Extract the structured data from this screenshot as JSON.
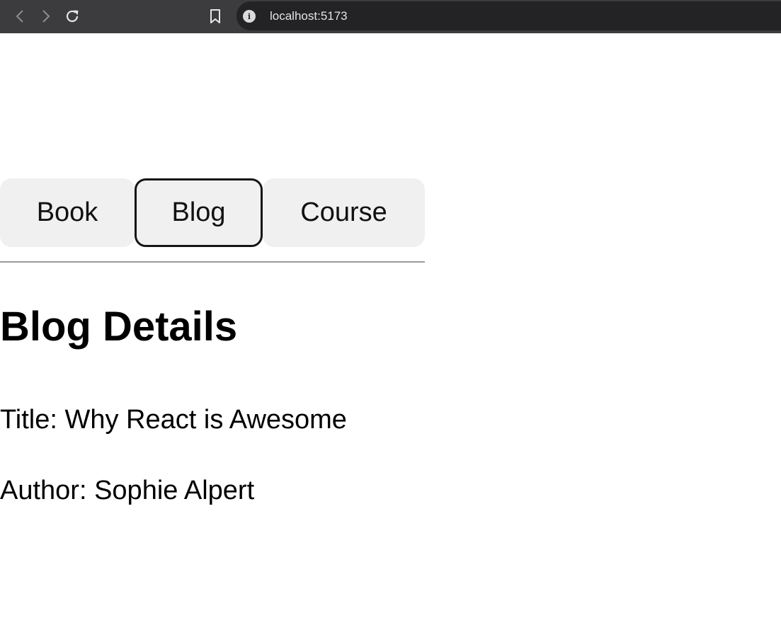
{
  "browser": {
    "url": "localhost:5173",
    "icons": {
      "back": "chevron-left-icon",
      "forward": "chevron-right-icon",
      "reload": "reload-icon",
      "bookmark": "bookmark-icon",
      "site_info": "info-icon"
    }
  },
  "tabs": [
    {
      "label": "Book",
      "selected": false
    },
    {
      "label": "Blog",
      "selected": true
    },
    {
      "label": "Course",
      "selected": false
    }
  ],
  "details": {
    "heading": "Blog Details",
    "title_line": "Title: Why React is Awesome",
    "author_line": "Author: Sophie Alpert"
  },
  "colors": {
    "browser_bar": "#3c3c3f",
    "address_bar": "#232326",
    "tab_background": "#f0f0f0",
    "selected_tab_border": "#151515"
  }
}
